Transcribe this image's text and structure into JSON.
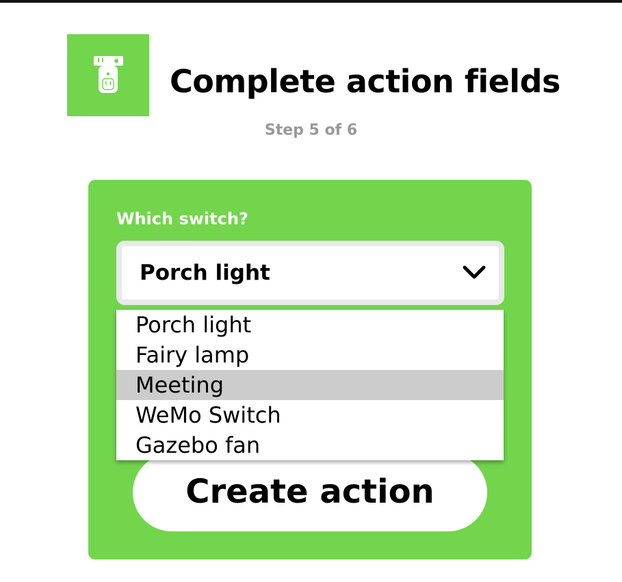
{
  "header": {
    "service_icon": "wemo-smart-plug-icon",
    "title": "Complete action fields",
    "step": "Step 5 of 6"
  },
  "action_form": {
    "field_label": "Which switch?",
    "selected_value": "Porch light",
    "dropdown_icon": "chevron-down-icon",
    "options": [
      {
        "label": "Porch light",
        "highlighted": false
      },
      {
        "label": "Fairy lamp",
        "highlighted": false
      },
      {
        "label": "Meeting",
        "highlighted": true
      },
      {
        "label": "WeMo Switch",
        "highlighted": false
      },
      {
        "label": "Gazebo fan",
        "highlighted": false
      }
    ],
    "submit_label": "Create action"
  },
  "colors": {
    "brand_green": "#72d54c",
    "option_highlight": "#cccccc",
    "step_text": "#999999",
    "select_border": "#e9e9e9"
  }
}
